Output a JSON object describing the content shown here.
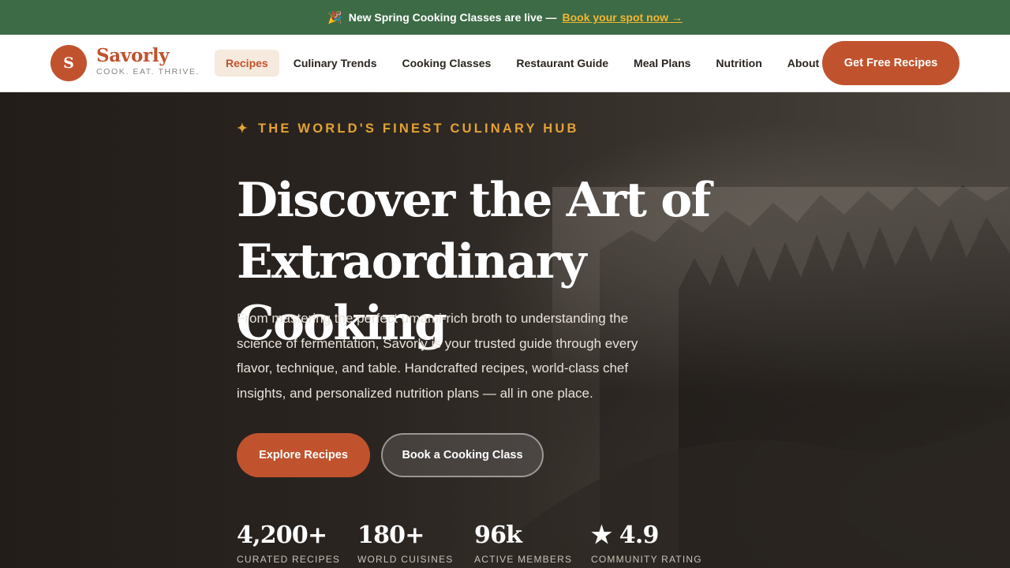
{
  "announcement": {
    "icon": "party-popper-icon",
    "text": "New Spring Cooking Classes are live —",
    "link_label": "Book your spot now →"
  },
  "brand": {
    "initial": "S",
    "name": "Savorly",
    "tagline": "COOK. EAT. THRIVE.",
    "accent_color": "#c0532e"
  },
  "nav": {
    "items": [
      {
        "label": "Recipes",
        "active": true
      },
      {
        "label": "Culinary Trends",
        "active": false
      },
      {
        "label": "Cooking Classes",
        "active": false
      },
      {
        "label": "Restaurant Guide",
        "active": false
      },
      {
        "label": "Meal Plans",
        "active": false
      },
      {
        "label": "Nutrition",
        "active": false
      },
      {
        "label": "About",
        "active": false
      }
    ],
    "cta_label": "Get Free Recipes"
  },
  "hero": {
    "eyebrow_icon": "✦",
    "eyebrow": "THE WORLD'S FINEST CULINARY HUB",
    "headline_line1": "Discover the Art of",
    "headline_line2": "Extraordinary Cooking",
    "lead": "From mastering the perfect umami-rich broth to understanding the science of fermentation, Savorly is your trusted guide through every flavor, technique, and table. Handcrafted recipes, world-class chef insights, and personalized nutrition plans — all in one place.",
    "primary_button": "Explore Recipes",
    "secondary_button": "Book a Cooking Class",
    "stats": [
      {
        "value": "4,200+",
        "label": "CURATED RECIPES"
      },
      {
        "value": "180+",
        "label": "WORLD CUISINES"
      },
      {
        "value": "96k",
        "label": "ACTIVE MEMBERS"
      },
      {
        "value": "★ 4.9",
        "label": "COMMUNITY RATING"
      }
    ]
  },
  "colors": {
    "announcement_bg": "#3c6b46",
    "link": "#f2b632",
    "eyebrow": "#e2a234",
    "primary": "#c0532e"
  }
}
